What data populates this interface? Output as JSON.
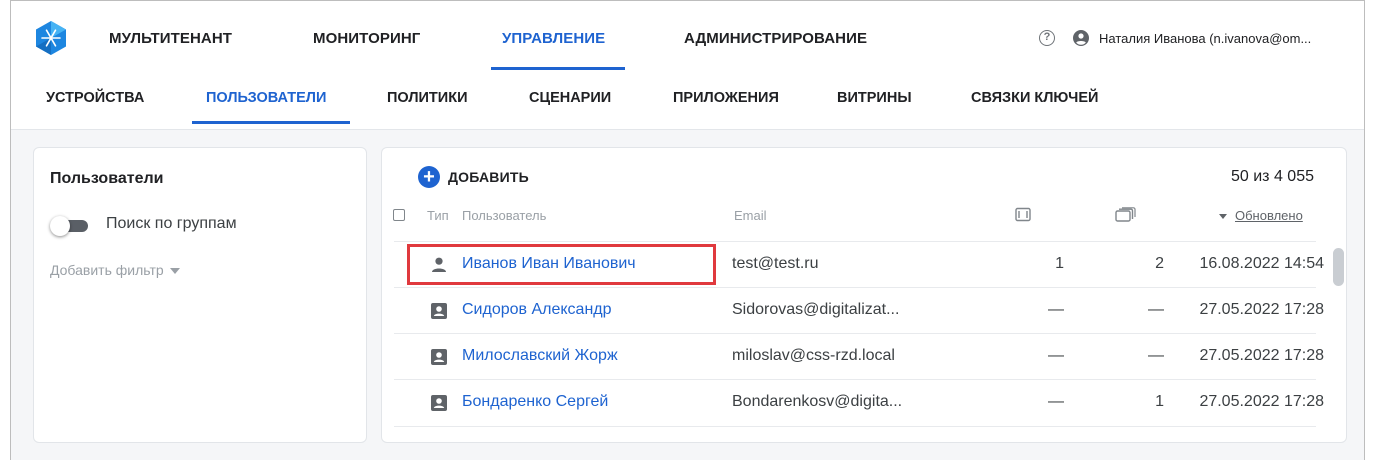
{
  "top_nav": {
    "tabs": [
      {
        "label": "МУЛЬТИТЕНАНТ"
      },
      {
        "label": "МОНИТОРИНГ"
      },
      {
        "label": "УПРАВЛЕНИЕ"
      },
      {
        "label": "АДМИНИСТРИРОВАНИЕ"
      }
    ],
    "active_tab": "УПРАВЛЕНИЕ",
    "help_icon": "question-circle-icon",
    "user_icon": "account-circle-icon",
    "user_name": "Наталия Иванова (n.ivanova@om..."
  },
  "sub_nav": {
    "tabs": [
      {
        "label": "УСТРОЙСТВА"
      },
      {
        "label": "ПОЛЬЗОВАТЕЛИ"
      },
      {
        "label": "ПОЛИТИКИ"
      },
      {
        "label": "СЦЕНАРИИ"
      },
      {
        "label": "ПРИЛОЖЕНИЯ"
      },
      {
        "label": "ВИТРИНЫ"
      },
      {
        "label": "СВЯЗКИ КЛЮЧЕЙ"
      }
    ],
    "active_tab": "ПОЛЬЗОВАТЕЛИ"
  },
  "filter_panel": {
    "title": "Пользователи",
    "group_search_toggle": {
      "label": "Поиск по группам",
      "on": false
    },
    "add_filter_label": "Добавить фильтр"
  },
  "users_table": {
    "add_button_label": "ДОБАВИТЬ",
    "count_text": "50 из 4 055",
    "columns": {
      "type": "Тип",
      "user": "Пользователь",
      "email": "Email",
      "devices_icon": "devices-icon",
      "groups_icon": "stacked-cards-icon",
      "updated": "Обновлено"
    },
    "sort": {
      "column": "Обновлено",
      "direction": "desc"
    },
    "rows": [
      {
        "type_icon": "person-icon",
        "name": "Иванов Иван Иванович",
        "email": "test@test.ru",
        "devices": "1",
        "groups": "2",
        "updated": "16.08.2022 14:54",
        "highlighted": true
      },
      {
        "type_icon": "contact-card-icon",
        "name": "Сидоров Александр",
        "email": "Sidorovas@digitalizat...",
        "devices": "—",
        "groups": "—",
        "updated": "27.05.2022 17:28"
      },
      {
        "type_icon": "contact-card-icon",
        "name": "Милославский Жорж",
        "email": "miloslav@css-rzd.local",
        "devices": "—",
        "groups": "—",
        "updated": "27.05.2022 17:28"
      },
      {
        "type_icon": "contact-card-icon",
        "name": "Бондаренко Сергей",
        "email": "Bondarenkosv@digita...",
        "devices": "—",
        "groups": "1",
        "updated": "27.05.2022 17:28"
      }
    ]
  },
  "colors": {
    "accent": "#1e63d0",
    "highlight_border": "#e0393e",
    "background": "#f5f6f8"
  }
}
